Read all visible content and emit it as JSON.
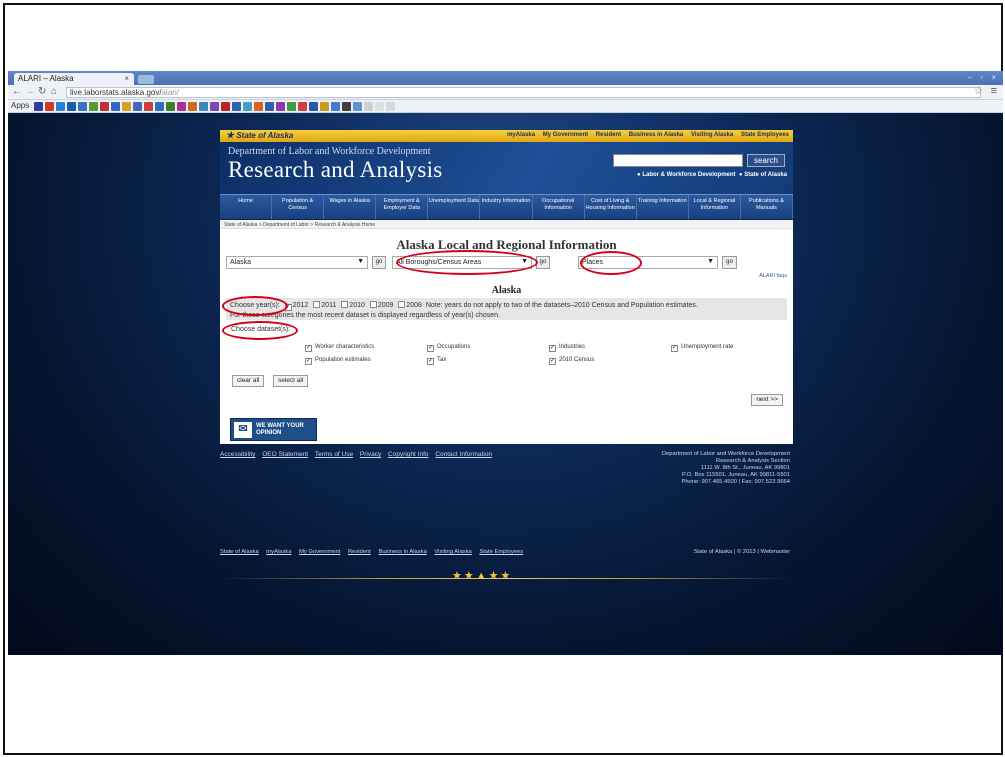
{
  "browser": {
    "tab_title": "ALARI – Alaska",
    "tab_close": "×",
    "window_controls": "– ▫ ×",
    "url_host": "live.laborstats.alaska.gov/",
    "url_path": "alari/",
    "apps_label": "Apps",
    "bookmark_colors": [
      "#2f3fa0",
      "#d03a2a",
      "#2b7fd0",
      "#1d5ca8",
      "#3a6fc8",
      "#5a9a30",
      "#c22f2f",
      "#3068c6",
      "#d8a020",
      "#4466bb",
      "#c94040",
      "#2f6fc0",
      "#3b7d2b",
      "#aa2f8f",
      "#d06a20",
      "#3a88c0",
      "#7a4ab0",
      "#c02020",
      "#2d62b0",
      "#40a0c0",
      "#e06020",
      "#3060a8",
      "#8a3ab0",
      "#3d9a40",
      "#d04040",
      "#2a58a8",
      "#c89a20",
      "#4a7ad0",
      "#3f3f3f",
      "#6090d0",
      "#d0d0d0",
      "#e0e0e0",
      "#d8d8d8"
    ]
  },
  "header": {
    "state_label": "State of Alaska",
    "top_links": [
      "myAlaska",
      "My Government",
      "Resident",
      "Business in Alaska",
      "Visiting Alaska",
      "State Employees"
    ],
    "dept": "Department of Labor and Workforce Development",
    "title": "Research and Analysis",
    "search_label": "search",
    "radio_labels": [
      "Labor & Workforce Development",
      "State of Alaska"
    ]
  },
  "nav": {
    "items": [
      "Home",
      "Population & Census",
      "Wages in Alaska",
      "Employment & Employer Data",
      "Unemployment Data",
      "Industry Information",
      "Occupational Information",
      "Cost of Living & Housing Information",
      "Training Information",
      "Local & Regional Information",
      "Publications & Manuals"
    ]
  },
  "breadcrumb": "State of Alaska > Department of Labor > Research & Analysis Home",
  "main": {
    "heading": "Alaska Local and Regional Information",
    "select_area": "Alaska",
    "select_borough": "All Boroughs/Census Areas",
    "select_places": "Places",
    "go_label": "go",
    "faqs": "ALARI faqs",
    "subheading": "Alaska",
    "choose_years": "Choose year(s):",
    "years": [
      "2012",
      "2011",
      "2010",
      "2009",
      "2008"
    ],
    "years_checked": [
      true,
      false,
      false,
      false,
      false
    ],
    "years_note": "Note: years do not apply to two of the datasets–2010 Census and Population estimates.",
    "years_note2": "For these categories the most recent dataset is displayed regardless of year(s) chosen.",
    "choose_datasets": "Choose dataset(s):",
    "datasets": [
      "Worker characteristics",
      "Occupations",
      "Industries",
      "Unemployment rate",
      "Population estimates",
      "Tax",
      "2010 Census"
    ],
    "clear_all": "clear all",
    "select_all": "select all",
    "next": "next >>",
    "opinion": "WE WANT YOUR OPINION"
  },
  "footer": {
    "links": [
      "Accessibility",
      "OEO Statement",
      "Terms of Use",
      "Privacy",
      "Copyright Info",
      "Contact Information"
    ],
    "address": [
      "Department of Labor and Workforce Development",
      "Research & Analysis Section",
      "1111 W. 8th St., Juneau, AK 99801",
      "P.O. Box 115501, Juneau, AK 99811-5501",
      "Phone: 907.465.4500 | Fax: 907.523.9664"
    ],
    "bottom_links": [
      "State of Alaska",
      "myAlaska",
      "My Government",
      "Resident",
      "Business in Alaska",
      "Visiting Alaska",
      "State Employees"
    ],
    "copyright": "State of Alaska | © 2013 | Webmaster"
  }
}
